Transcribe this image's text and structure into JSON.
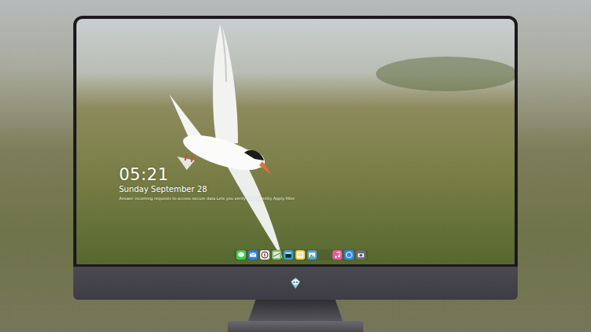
{
  "lock_screen": {
    "time": "05:21",
    "date": "Sunday September 28",
    "notice": "Answer incoming requests to access secure data  Lets you verify your identity  Apply  filter"
  }
}
